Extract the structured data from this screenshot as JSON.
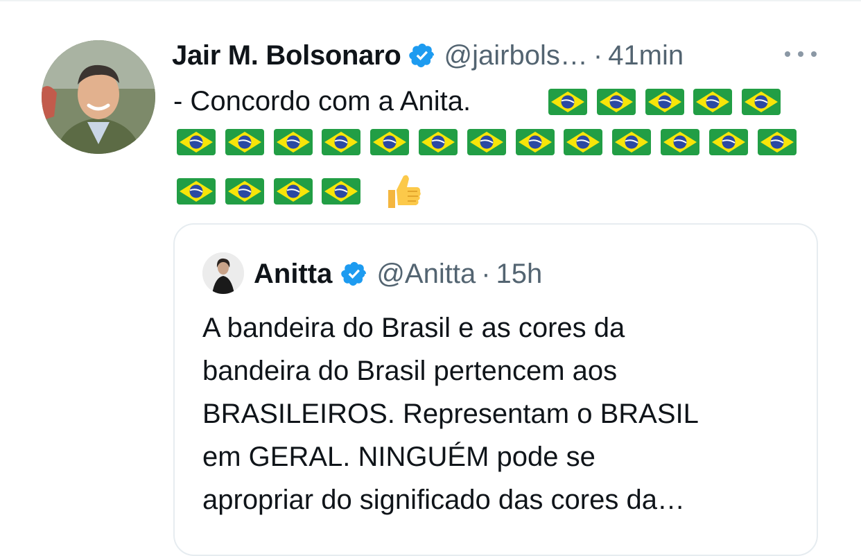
{
  "tweet": {
    "author": {
      "name": "Jair M. Bolsonaro",
      "handle": "@jairbols…",
      "separator": "·",
      "time": "41min",
      "avatar_icon": "profile-photo"
    },
    "text_line": "- Concordo com a Anita.",
    "emoji": {
      "flag_icon": "brazil-flag-icon",
      "flag_count": 22,
      "flags_per_row": [
        5,
        13,
        4
      ],
      "trailing_icon": "thumbs-up-icon"
    },
    "more_icon": "more-options-icon"
  },
  "quoted_tweet": {
    "author": {
      "name": "Anitta",
      "handle": "@Anitta",
      "separator": "·",
      "time": "15h"
    },
    "lines": [
      "A bandeira do Brasil e as cores da",
      "bandeira do Brasil pertencem aos",
      "BRASILEIROS. Representam o BRASIL",
      "em GERAL. NINGUÉM pode se",
      "apropriar do significado das cores da…"
    ]
  },
  "colors": {
    "text": "#0f1419",
    "secondary": "#536471",
    "verified": "#1d9bf0",
    "border": "#e6ecf0",
    "flag_green": "#229e45",
    "flag_yellow": "#f8e509",
    "flag_blue": "#2b49a3"
  }
}
